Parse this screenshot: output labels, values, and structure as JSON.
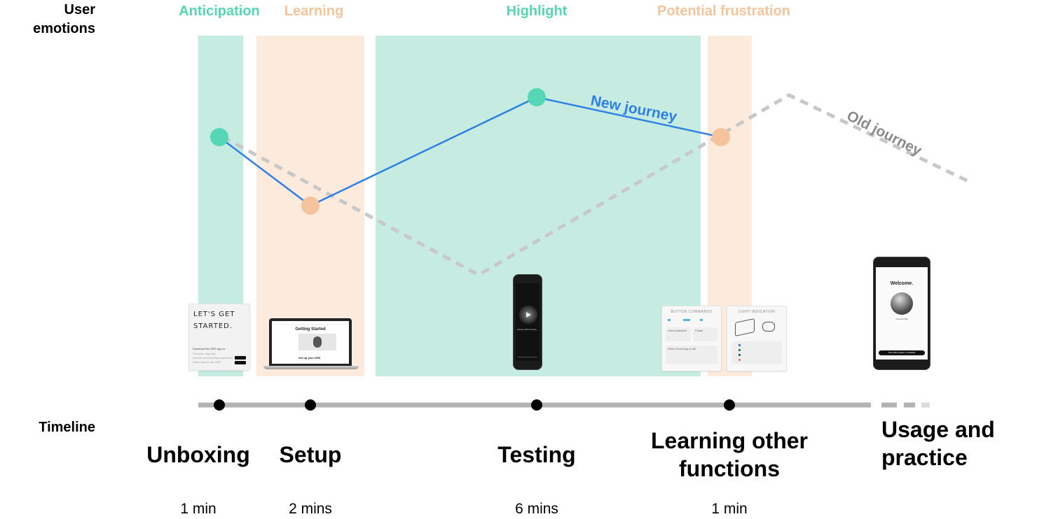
{
  "row_labels": {
    "emotions": [
      "User",
      "emotions"
    ],
    "timeline": "Timeline"
  },
  "colors": {
    "positive": "#55d6b5",
    "positive_band": "#c6ece2",
    "negative": "#f5c49c",
    "negative_band": "#fcebdd",
    "new_journey": "#2f80e5",
    "old_journey": "#c8c8c8",
    "old_journey_label": "#8a8a8a",
    "timeline_bar": "#b3b3b3",
    "timeline_dot": "#000000"
  },
  "emotion_zones": [
    {
      "label": "Anticipation",
      "tone": "positive"
    },
    {
      "label": "Learning",
      "tone": "negative"
    },
    {
      "label": "Highlight",
      "tone": "positive"
    },
    {
      "label": "Potential frustration",
      "tone": "negative"
    }
  ],
  "journeys": {
    "new": {
      "label": "New journey",
      "points": [
        {
          "stage": "Unboxing",
          "emotion": "positive"
        },
        {
          "stage": "Setup",
          "emotion": "negative"
        },
        {
          "stage": "Testing",
          "emotion": "positive"
        },
        {
          "stage": "Learning other functions",
          "emotion": "negative"
        }
      ]
    },
    "old": {
      "label": "Old journey"
    }
  },
  "stages": [
    {
      "title": [
        "Unboxing"
      ],
      "duration": "1 min"
    },
    {
      "title": [
        "Setup"
      ],
      "duration": "2 mins"
    },
    {
      "title": [
        "Testing"
      ],
      "duration": "6 mins"
    },
    {
      "title": [
        "Learning other",
        "functions"
      ],
      "duration": "1 min"
    },
    {
      "title": [
        "Usage and",
        "practice"
      ],
      "duration": ""
    }
  ],
  "thumbnails": {
    "card": {
      "title": [
        "LET'S GET",
        "STARTED."
      ],
      "subtitle": "Download the DRII app to:",
      "lines": [
        "Find your ring size",
        "Get the best hearing experience",
        "Learn how to use DRII"
      ]
    },
    "laptop": {
      "heading": "Getting Started",
      "subheading": "Set up your DRII"
    },
    "phone_testing": {
      "status": "Playing DRII briefing..."
    },
    "button_commands": {
      "title": "BUTTON COMMANDS",
      "sections": [
        "Voice Assistant",
        "Power",
        "When Receiving a call"
      ]
    },
    "light_indication": {
      "title": "LIGHT INDICATION"
    },
    "phone_welcome": {
      "title": "Welcome.",
      "caption": "Connect KAI",
      "banner": "New DRII update is available"
    }
  }
}
